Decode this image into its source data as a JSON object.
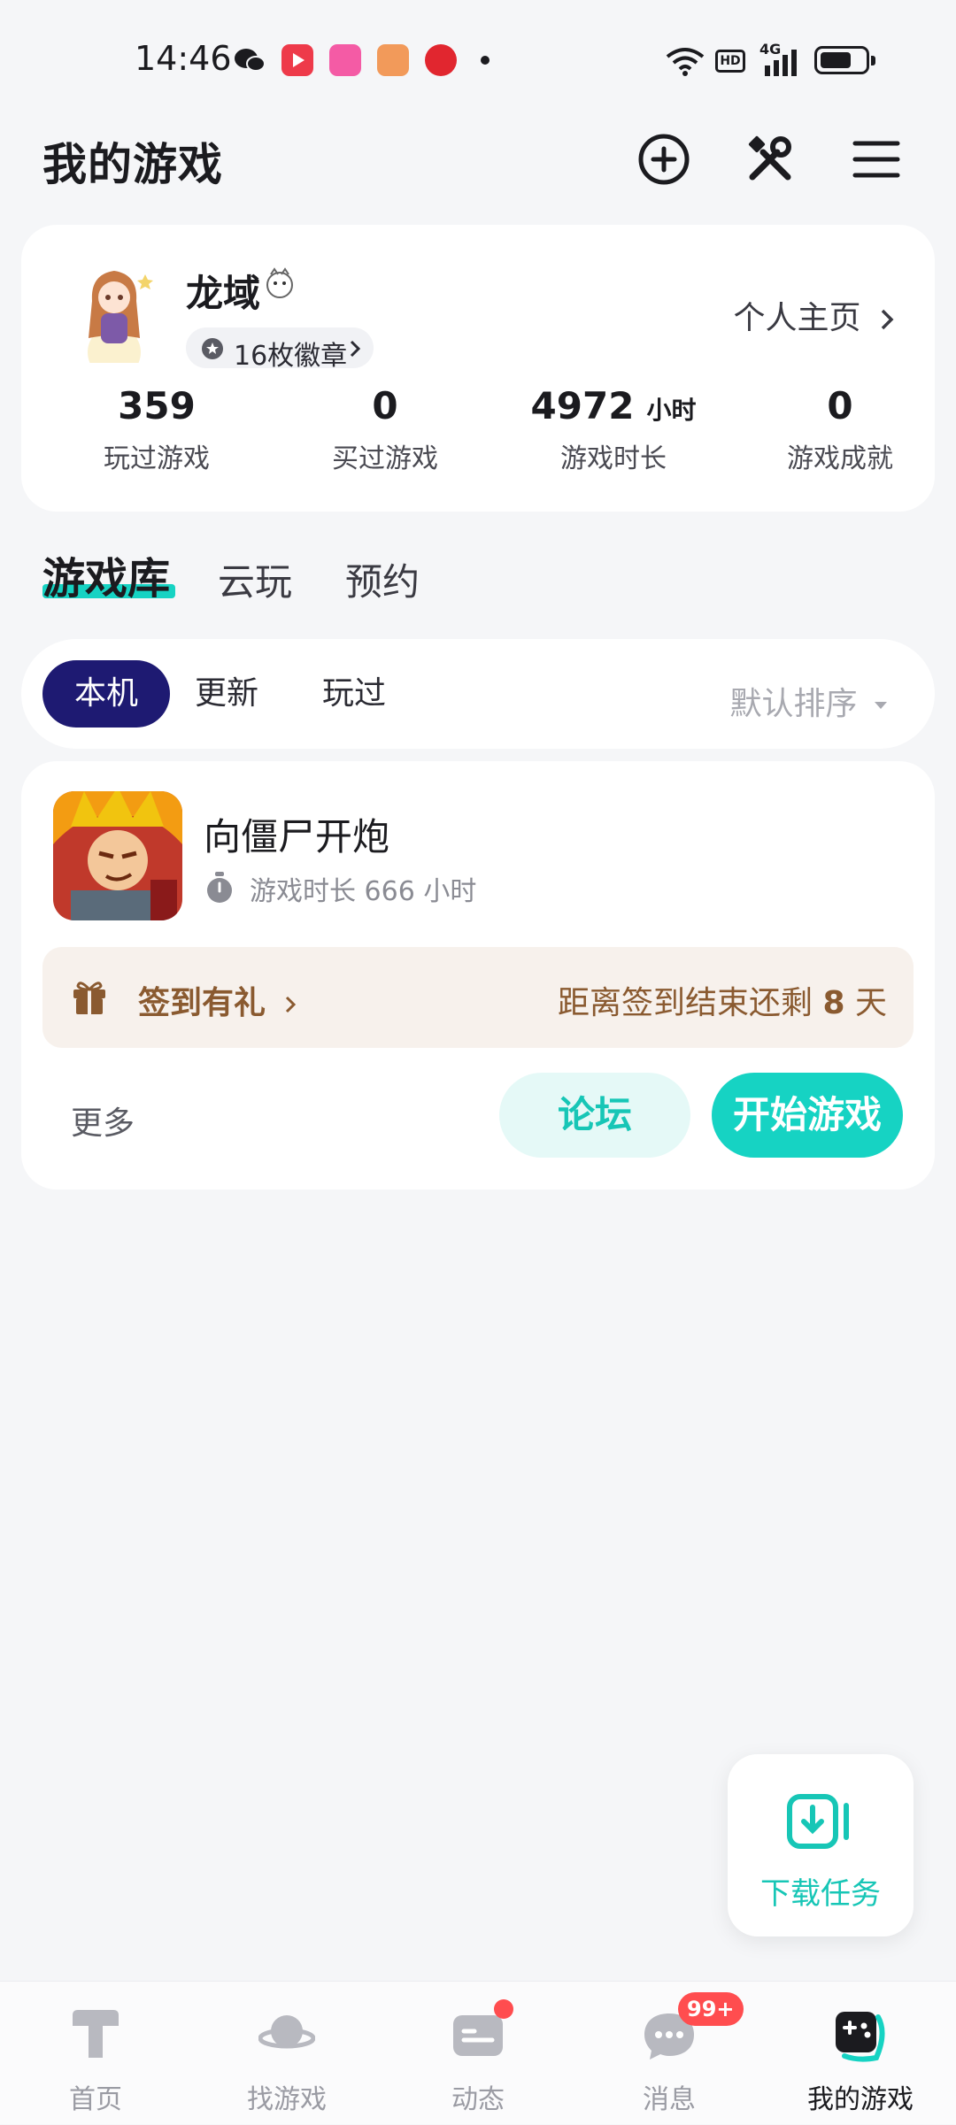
{
  "status_bar": {
    "time": "14:46",
    "network": "4G",
    "hd": "HD"
  },
  "header": {
    "title": "我的游戏"
  },
  "profile": {
    "nickname": "龙域",
    "badges_label": "16枚徽章",
    "homepage_link": "个人主页",
    "stats": [
      {
        "value": "359",
        "unit": "",
        "label": "玩过游戏"
      },
      {
        "value": "0",
        "unit": "",
        "label": "买过游戏"
      },
      {
        "value": "4972",
        "unit": "小时",
        "label": "游戏时长"
      },
      {
        "value": "0",
        "unit": "",
        "label": "游戏成就"
      }
    ]
  },
  "main_tabs": [
    {
      "label": "游戏库",
      "active": true
    },
    {
      "label": "云玩",
      "active": false
    },
    {
      "label": "预约",
      "active": false
    }
  ],
  "filter": {
    "chips": [
      "本机",
      "更新",
      "玩过"
    ],
    "active_chip": "本机",
    "sort_label": "默认排序"
  },
  "game": {
    "name": "向僵尸开炮",
    "play_time": "游戏时长 666 小时",
    "checkin_label": "签到有礼",
    "checkin_remain_prefix": "距离签到结束还剩 ",
    "checkin_remain_days": "8",
    "checkin_remain_suffix": " 天",
    "more_label": "更多",
    "forum_button": "论坛",
    "start_button": "开始游戏"
  },
  "float_button": {
    "label": "下载任务"
  },
  "bottom_nav": {
    "items": [
      {
        "label": "首页",
        "icon": "home-icon"
      },
      {
        "label": "找游戏",
        "icon": "planet-icon"
      },
      {
        "label": "动态",
        "icon": "feed-icon"
      },
      {
        "label": "消息",
        "icon": "message-icon",
        "badge": "99+"
      },
      {
        "label": "我的游戏",
        "icon": "gamepad-icon",
        "active": true
      }
    ]
  },
  "colors": {
    "accent": "#16d3c3",
    "chip_active": "#1e1a72",
    "badge_red": "#ff4d4f",
    "checkin_text": "#8a5a30"
  }
}
